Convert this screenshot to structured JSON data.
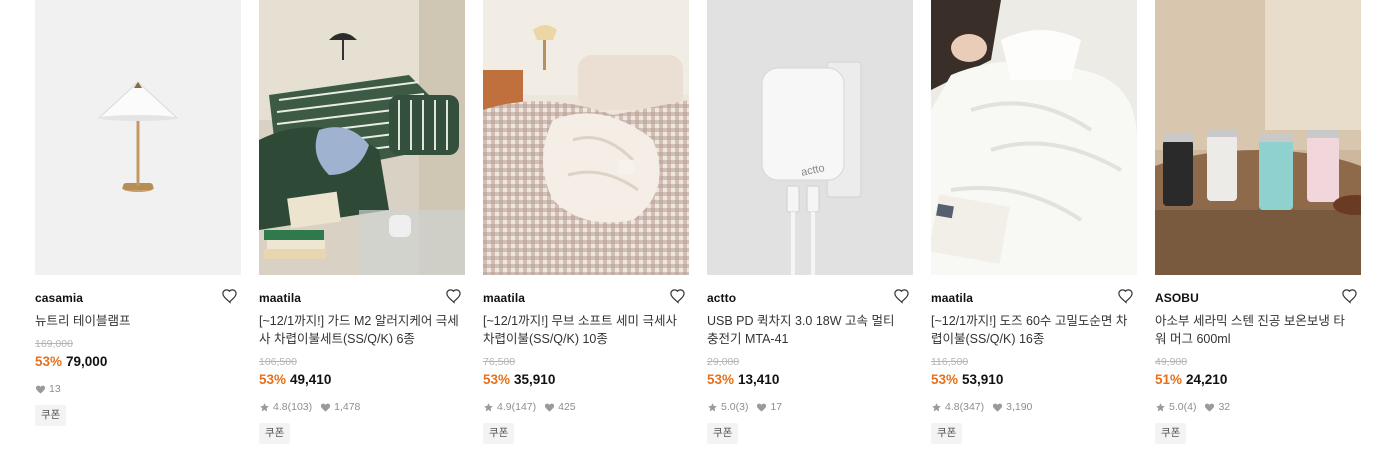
{
  "products": [
    {
      "brand": "casamia",
      "title": "뉴트리 테이블램프",
      "original_price": "169,000",
      "discount": "53%",
      "price": "79,000",
      "rating": "",
      "reviews": "",
      "likes": "13",
      "coupon": "쿠폰",
      "image_icon": "table-lamp-photo"
    },
    {
      "brand": "maatila",
      "title": "[~12/1까지!] 가드 M2 알러지케어 극세사 차렵이불세트(SS/Q/K) 6종",
      "original_price": "106,500",
      "discount": "53%",
      "price": "49,410",
      "rating": "4.8",
      "reviews": "(103)",
      "likes": "1,478",
      "coupon": "쿠폰",
      "image_icon": "green-bedding-photo"
    },
    {
      "brand": "maatila",
      "title": "[~12/1까지!] 무브 소프트 세미 극세사 차렵이불(SS/Q/K) 10종",
      "original_price": "76,500",
      "discount": "53%",
      "price": "35,910",
      "rating": "4.9",
      "reviews": "(147)",
      "likes": "425",
      "coupon": "쿠폰",
      "image_icon": "gingham-bedding-photo"
    },
    {
      "brand": "actto",
      "title": "USB PD 퀵차지 3.0 18W 고속 멀티 충전기 MTA-41",
      "original_price": "29,000",
      "discount": "53%",
      "price": "13,410",
      "rating": "5.0",
      "reviews": "(3)",
      "likes": "17",
      "coupon": "쿠폰",
      "image_icon": "usb-charger-photo",
      "image_text": "actto"
    },
    {
      "brand": "maatila",
      "title": "[~12/1까지!] 도즈 60수 고밀도순면 차렵이불(SS/Q/K) 16종",
      "original_price": "116,500",
      "discount": "53%",
      "price": "53,910",
      "rating": "4.8",
      "reviews": "(347)",
      "likes": "3,190",
      "coupon": "쿠폰",
      "image_icon": "white-bedding-photo"
    },
    {
      "brand": "ASOBU",
      "title": "아소부 세라믹 스텐 진공 보온보냉 타워 머그 600ml",
      "original_price": "49,900",
      "discount": "51%",
      "price": "24,210",
      "rating": "5.0",
      "reviews": "(4)",
      "likes": "32",
      "coupon": "쿠폰",
      "image_icon": "tumblers-photo"
    }
  ]
}
